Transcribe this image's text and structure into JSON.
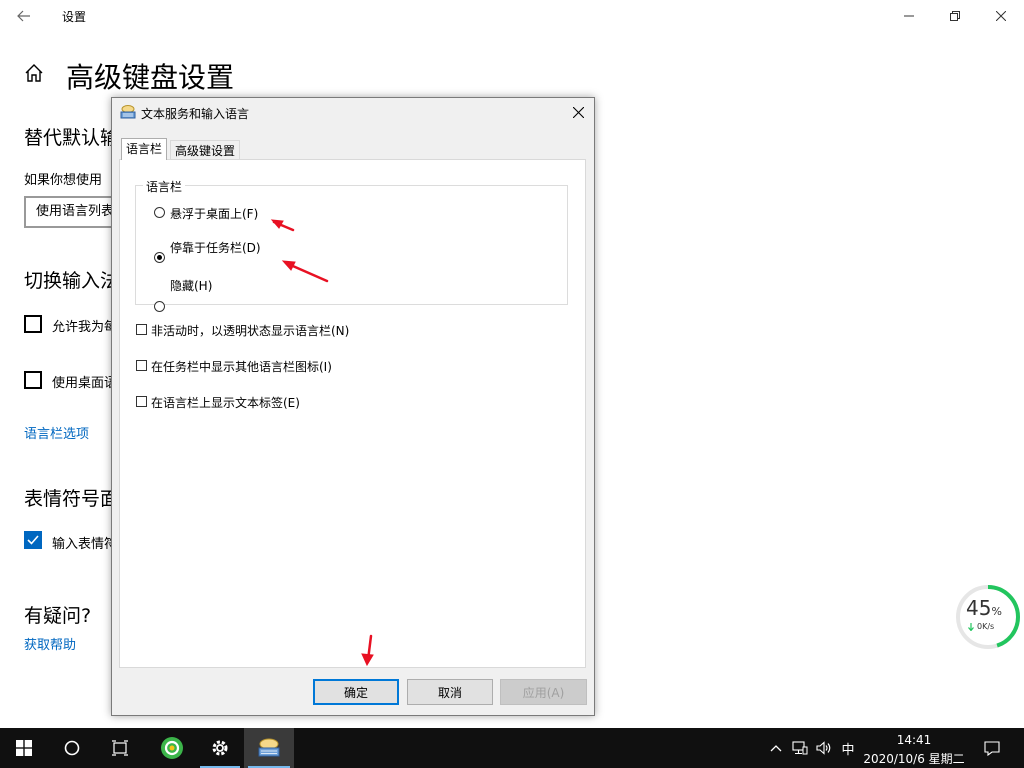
{
  "settings_window": {
    "title": "设置",
    "page_title": "高级键盘设置",
    "section_override": "替代默认输",
    "override_desc": "如果你想使用",
    "override_select": "使用语言列表",
    "section_switch": "切换输入法",
    "check_allow": "允许我为每",
    "check_desktop": "使用桌面语",
    "link_langbar": "语言栏选项",
    "section_emoji": "表情符号面",
    "check_emoji": "输入表情符",
    "section_question": "有疑问?",
    "link_help": "获取帮助"
  },
  "dialog": {
    "title": "文本服务和输入语言",
    "tabs": [
      {
        "label": "语言栏",
        "active": true
      },
      {
        "label": "高级键设置",
        "active": false
      }
    ],
    "group_label": "语言栏",
    "radios": [
      {
        "label": "悬浮于桌面上(F)",
        "checked": false
      },
      {
        "label": "停靠于任务栏(D)",
        "checked": true
      },
      {
        "label": "隐藏(H)",
        "checked": false
      }
    ],
    "checkboxes": [
      {
        "label": "非活动时，以透明状态显示语言栏(N)",
        "checked": false
      },
      {
        "label": "在任务栏中显示其他语言栏图标(I)",
        "checked": false
      },
      {
        "label": "在语言栏上显示文本标签(E)",
        "checked": false
      }
    ],
    "buttons": {
      "ok": "确定",
      "cancel": "取消",
      "apply": "应用(A)"
    }
  },
  "network_widget": {
    "percent": "45",
    "percent_unit": "%",
    "speed": "0K/s",
    "progress_value": 45
  },
  "taskbar": {
    "ime": "中",
    "time": "14:41",
    "date": "2020/10/6 星期二"
  },
  "colors": {
    "accent": "#0067c0",
    "annotation_arrow": "#e81123",
    "gauge_green": "#22c55e"
  }
}
